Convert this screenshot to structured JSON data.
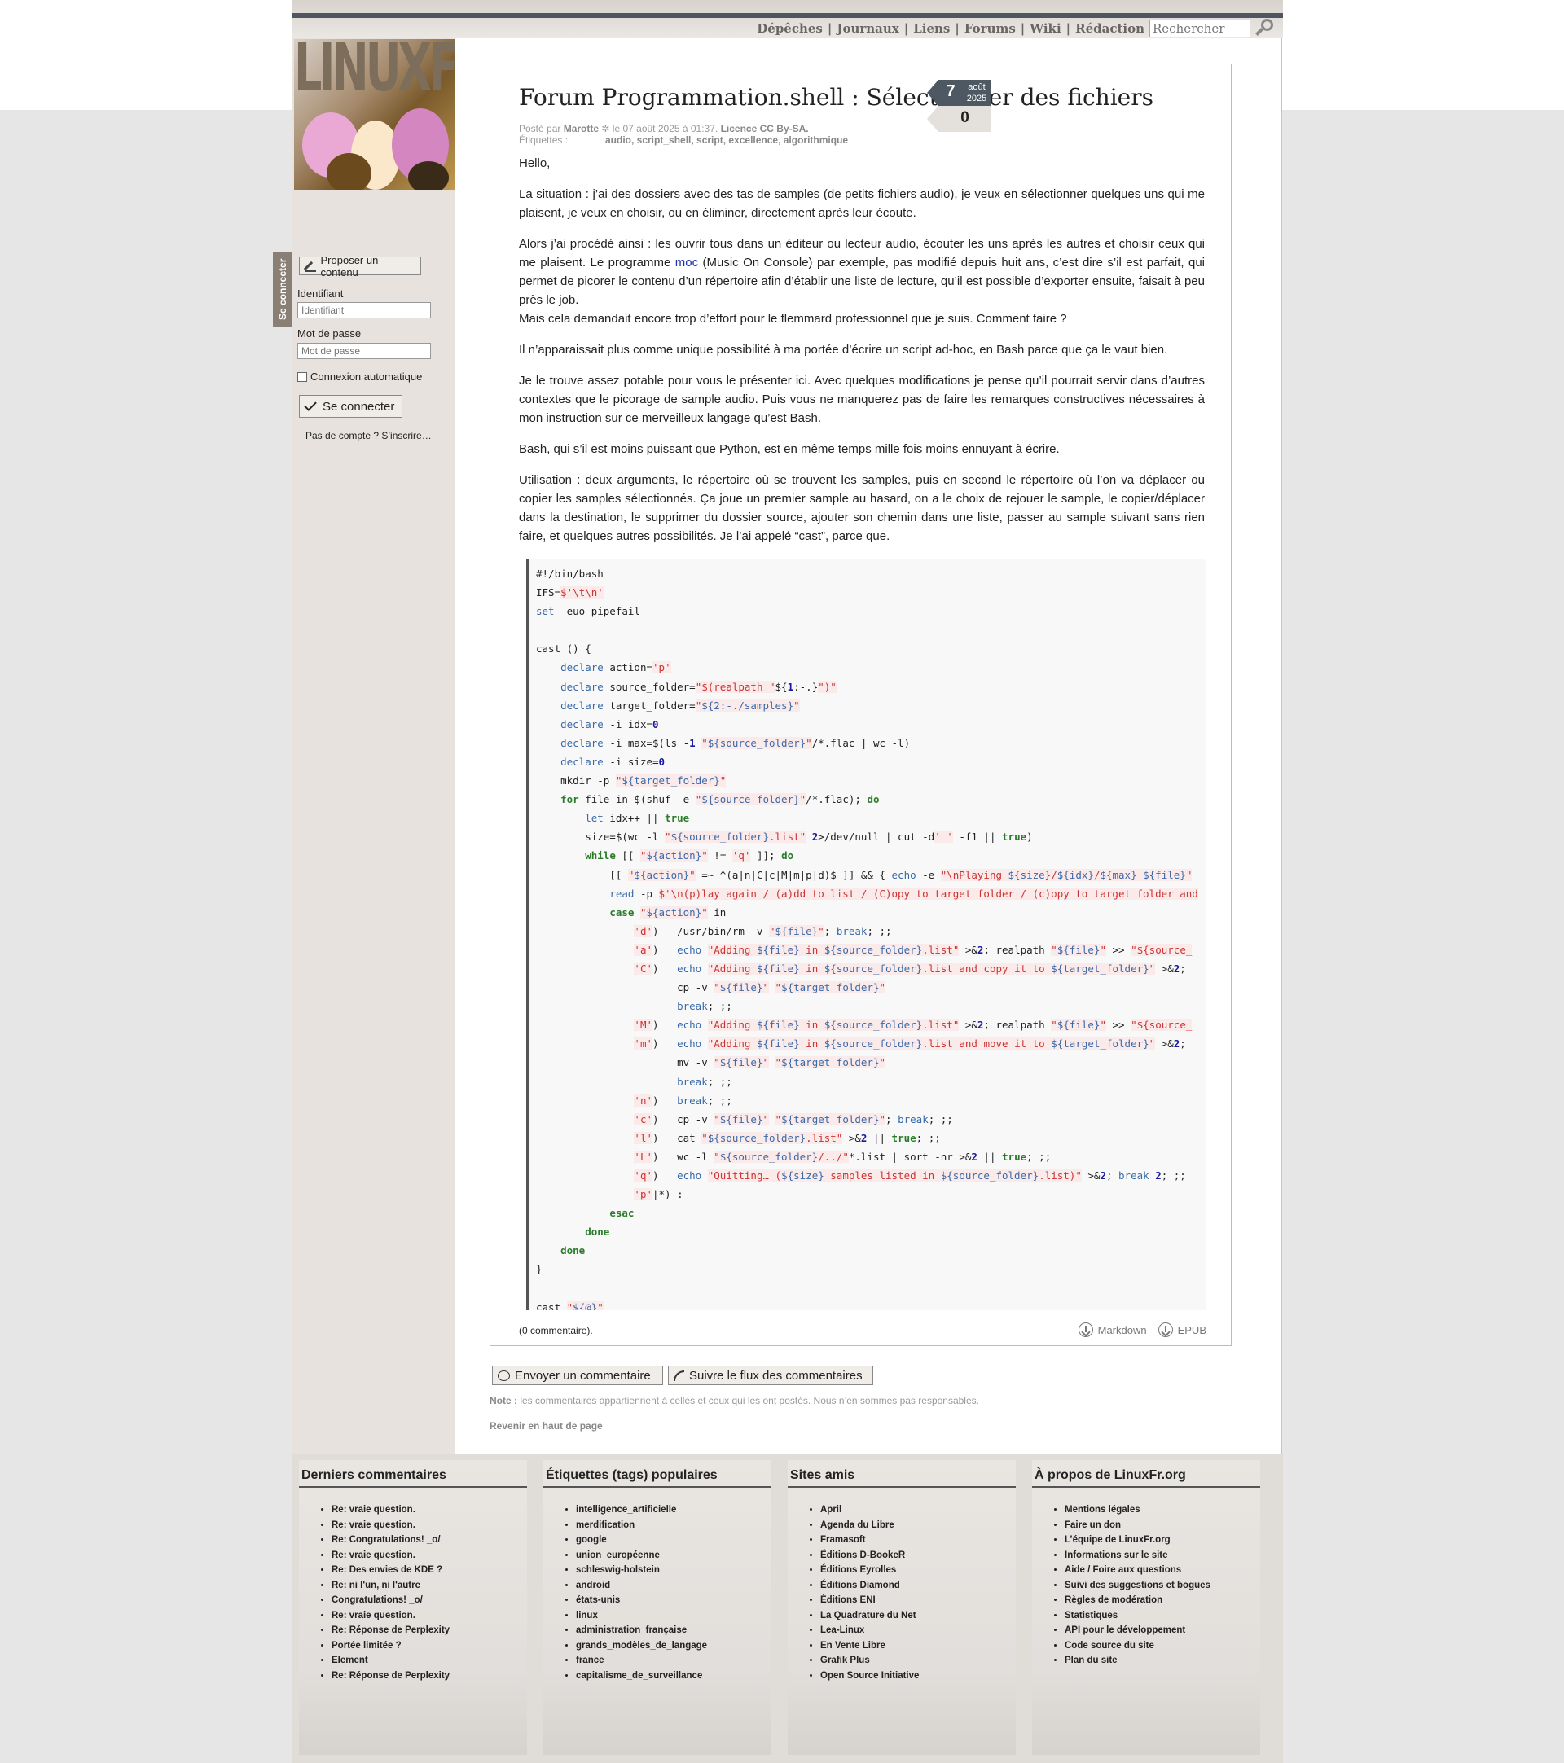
{
  "nav": {
    "items": [
      "Dépêches",
      "Journaux",
      "Liens",
      "Forums",
      "Wiki",
      "Rédaction"
    ],
    "search_placeholder": "Rechercher"
  },
  "logo": {
    "text": "LINUXFR.ORG"
  },
  "sidebar": {
    "tab": "Se connecter",
    "propose": "Proposer un contenu",
    "id_label": "Identifiant",
    "id_placeholder": "Identifiant",
    "pw_label": "Mot de passe",
    "pw_placeholder": "Mot de passe",
    "auto": "Connexion automatique",
    "login": "Se connecter",
    "signup": "Pas de compte ? S’inscrire…"
  },
  "date": {
    "day": "7",
    "month": "août",
    "year": "2025",
    "comments": "0"
  },
  "article": {
    "title": "Forum Programmation.shell : Sélectionner des fichiers",
    "meta_prefix": "Posté par",
    "author": "Marotte",
    "meta_date": "le 07 août 2025 à 01:37.",
    "licence": "Licence CC By‑SA.",
    "tags_label": "Étiquettes :",
    "tags": "audio, script_shell, script, excellence, algorithmique",
    "p0": "Hello,",
    "p1": "La situation : j’ai des dossiers avec des tas de samples (de petits fichiers audio), je veux en sélectionner quelques uns qui me plaisent, je veux en choisir, ou en éliminer, directement après leur écoute.",
    "p2a": "Alors j’ai procédé ainsi : les ouvrir tous dans un éditeur ou lecteur audio, écouter les uns après les autres et choisir ceux qui me plaisent. Le programme",
    "p2link": "moc",
    "p2b": "(Music On Console) par exemple, pas modifié depuis huit ans, c’est dire s’il est parfait, qui permet de picorer le contenu d’un répertoire afin d’établir une liste de lecture, qu’il est possible d’exporter ensuite, faisait à peu près le job.",
    "p2c": "Mais cela demandait encore trop d’effort pour le flemmard professionnel que je suis. Comment faire ?",
    "p3": "Il n’apparaissait plus comme unique possibilité à ma portée d’écrire un script ad-hoc, en Bash parce que ça le vaut bien.",
    "p4": "Je le trouve assez potable pour vous le présenter ici. Avec quelques modifications je pense qu’il pourrait servir dans d’autres contextes que le picorage de sample audio. Puis vous ne manquerez pas de faire les remarques constructives nécessaires à mon instruction sur ce merveilleux langage qu’est Bash.",
    "p5": "Bash, qui s’il est moins puissant que Python, est en même temps mille fois moins ennuyant à écrire.",
    "p6": "Utilisation : deux arguments, le répertoire où se trouvent les samples, puis en second le répertoire où l’on va déplacer ou copier les samples sélectionnés. Ça joue un premier sample au hasard, on a le choix de rejouer le sample, le copier/déplacer dans la destination, le supprimer du dossier source, ajouter son chemin dans une liste, passer au sample suivant sans rien faire, et quelques autres possibilités. Je l’ai appelé “cast”, parce que.",
    "comments_count": "(0 commentaire).",
    "dl_markdown": "Markdown",
    "dl_epub": "EPUB"
  },
  "code": [
    "#!/bin/bash",
    "IFS=$'\\t\\n'",
    "set -euo pipefail",
    "",
    "cast () {",
    "    declare action='p'",
    "    declare source_folder=\"$(realpath \"${1:-.}\")\"",
    "    declare target_folder=\"${2:-./samples}\"",
    "    declare -i idx=0",
    "    declare -i max=$(ls -1 \"${source_folder}\"/*.flac | wc -l)",
    "    declare -i size=0",
    "    mkdir -p \"${target_folder}\"",
    "    for file in $(shuf -e \"${source_folder}\"/*.flac); do",
    "        let idx++ || true",
    "        size=$(wc -l \"${source_folder}.list\" 2>/dev/null | cut -d' ' -f1 || true)",
    "        while [[ \"${action}\" != 'q' ]]; do",
    "            [[ \"${action}\" =~ ^(a|n|C|c|M|m|p|d)$ ]] && { echo -e \"\\nPlaying ${size}/${idx}/${max} ${file}\"",
    "            read -p $'\\n(p)lay again / (a)dd to list / (C)opy to target folder / (c)opy to target folder and",
    "            case \"${action}\" in",
    "                'd')   /usr/bin/rm -v \"${file}\"; break; ;;",
    "                'a')   echo \"Adding ${file} in ${source_folder}.list\" >&2; realpath \"${file}\" >> \"${source_",
    "                'C')   echo \"Adding ${file} in ${source_folder}.list and copy it to ${target_folder}\" >&2;",
    "                       cp -v \"${file}\" \"${target_folder}\"",
    "                       break; ;;",
    "                'M')   echo \"Adding ${file} in ${source_folder}.list\" >&2; realpath \"${file}\" >> \"${source_",
    "                'm')   echo \"Adding ${file} in ${source_folder}.list and move it to ${target_folder}\" >&2;",
    "                       mv -v \"${file}\" \"${target_folder}\"",
    "                       break; ;;",
    "                'n')   break; ;;",
    "                'c')   cp -v \"${file}\" \"${target_folder}\"; break; ;;",
    "                'l')   cat \"${source_folder}.list\" >&2 || true; ;;",
    "                'L')   wc -l \"${source_folder}/../\"*.list | sort -nr >&2 || true; ;;",
    "                'q')   echo \"Quitting… (${size} samples listed in ${source_folder}.list)\" >&2; break 2; ;;",
    "                'p'|*) :",
    "            esac",
    "        done",
    "    done",
    "}",
    "",
    "cast \"${@}\""
  ],
  "actions": {
    "send": "Envoyer un commentaire",
    "follow": "Suivre le flux des commentaires",
    "note_label": "Note :",
    "note": "les commentaires appartiennent à celles et ceux qui les ont postés. Nous n’en sommes pas responsables.",
    "backtop": "Revenir en haut de page"
  },
  "footer": {
    "c1": {
      "title": "Derniers commentaires",
      "items": [
        "Re: vraie question.",
        "Re: vraie question.",
        "Re: Congratulations! _o/",
        "Re: vraie question.",
        "Re: Des envies de KDE ?",
        "Re: ni l'un, ni l'autre",
        "Congratulations! _o/",
        "Re: vraie question.",
        "Re: Réponse de Perplexity",
        "Portée limitée ?",
        "Element",
        "Re: Réponse de Perplexity"
      ]
    },
    "c2": {
      "title": "Étiquettes (tags) populaires",
      "items": [
        "intelligence_artificielle",
        "merdification",
        "google",
        "union_européenne",
        "schleswig-holstein",
        "android",
        "états-unis",
        "linux",
        "administration_française",
        "grands_modèles_de_langage",
        "france",
        "capitalisme_de_surveillance"
      ]
    },
    "c3": {
      "title": "Sites amis",
      "items": [
        "April",
        "Agenda du Libre",
        "Framasoft",
        "Éditions D-BookeR",
        "Éditions Eyrolles",
        "Éditions Diamond",
        "Éditions ENI",
        "La Quadrature du Net",
        "Lea-Linux",
        "En Vente Libre",
        "Grafik Plus",
        "Open Source Initiative"
      ]
    },
    "c4": {
      "title": "À propos de LinuxFr.org",
      "items": [
        "Mentions légales",
        "Faire un don",
        "L’équipe de LinuxFr.org",
        "Informations sur le site",
        "Aide / Foire aux questions",
        "Suivi des suggestions et bogues",
        "Règles de modération",
        "Statistiques",
        "API pour le développement",
        "Code source du site",
        "Plan du site"
      ]
    }
  }
}
